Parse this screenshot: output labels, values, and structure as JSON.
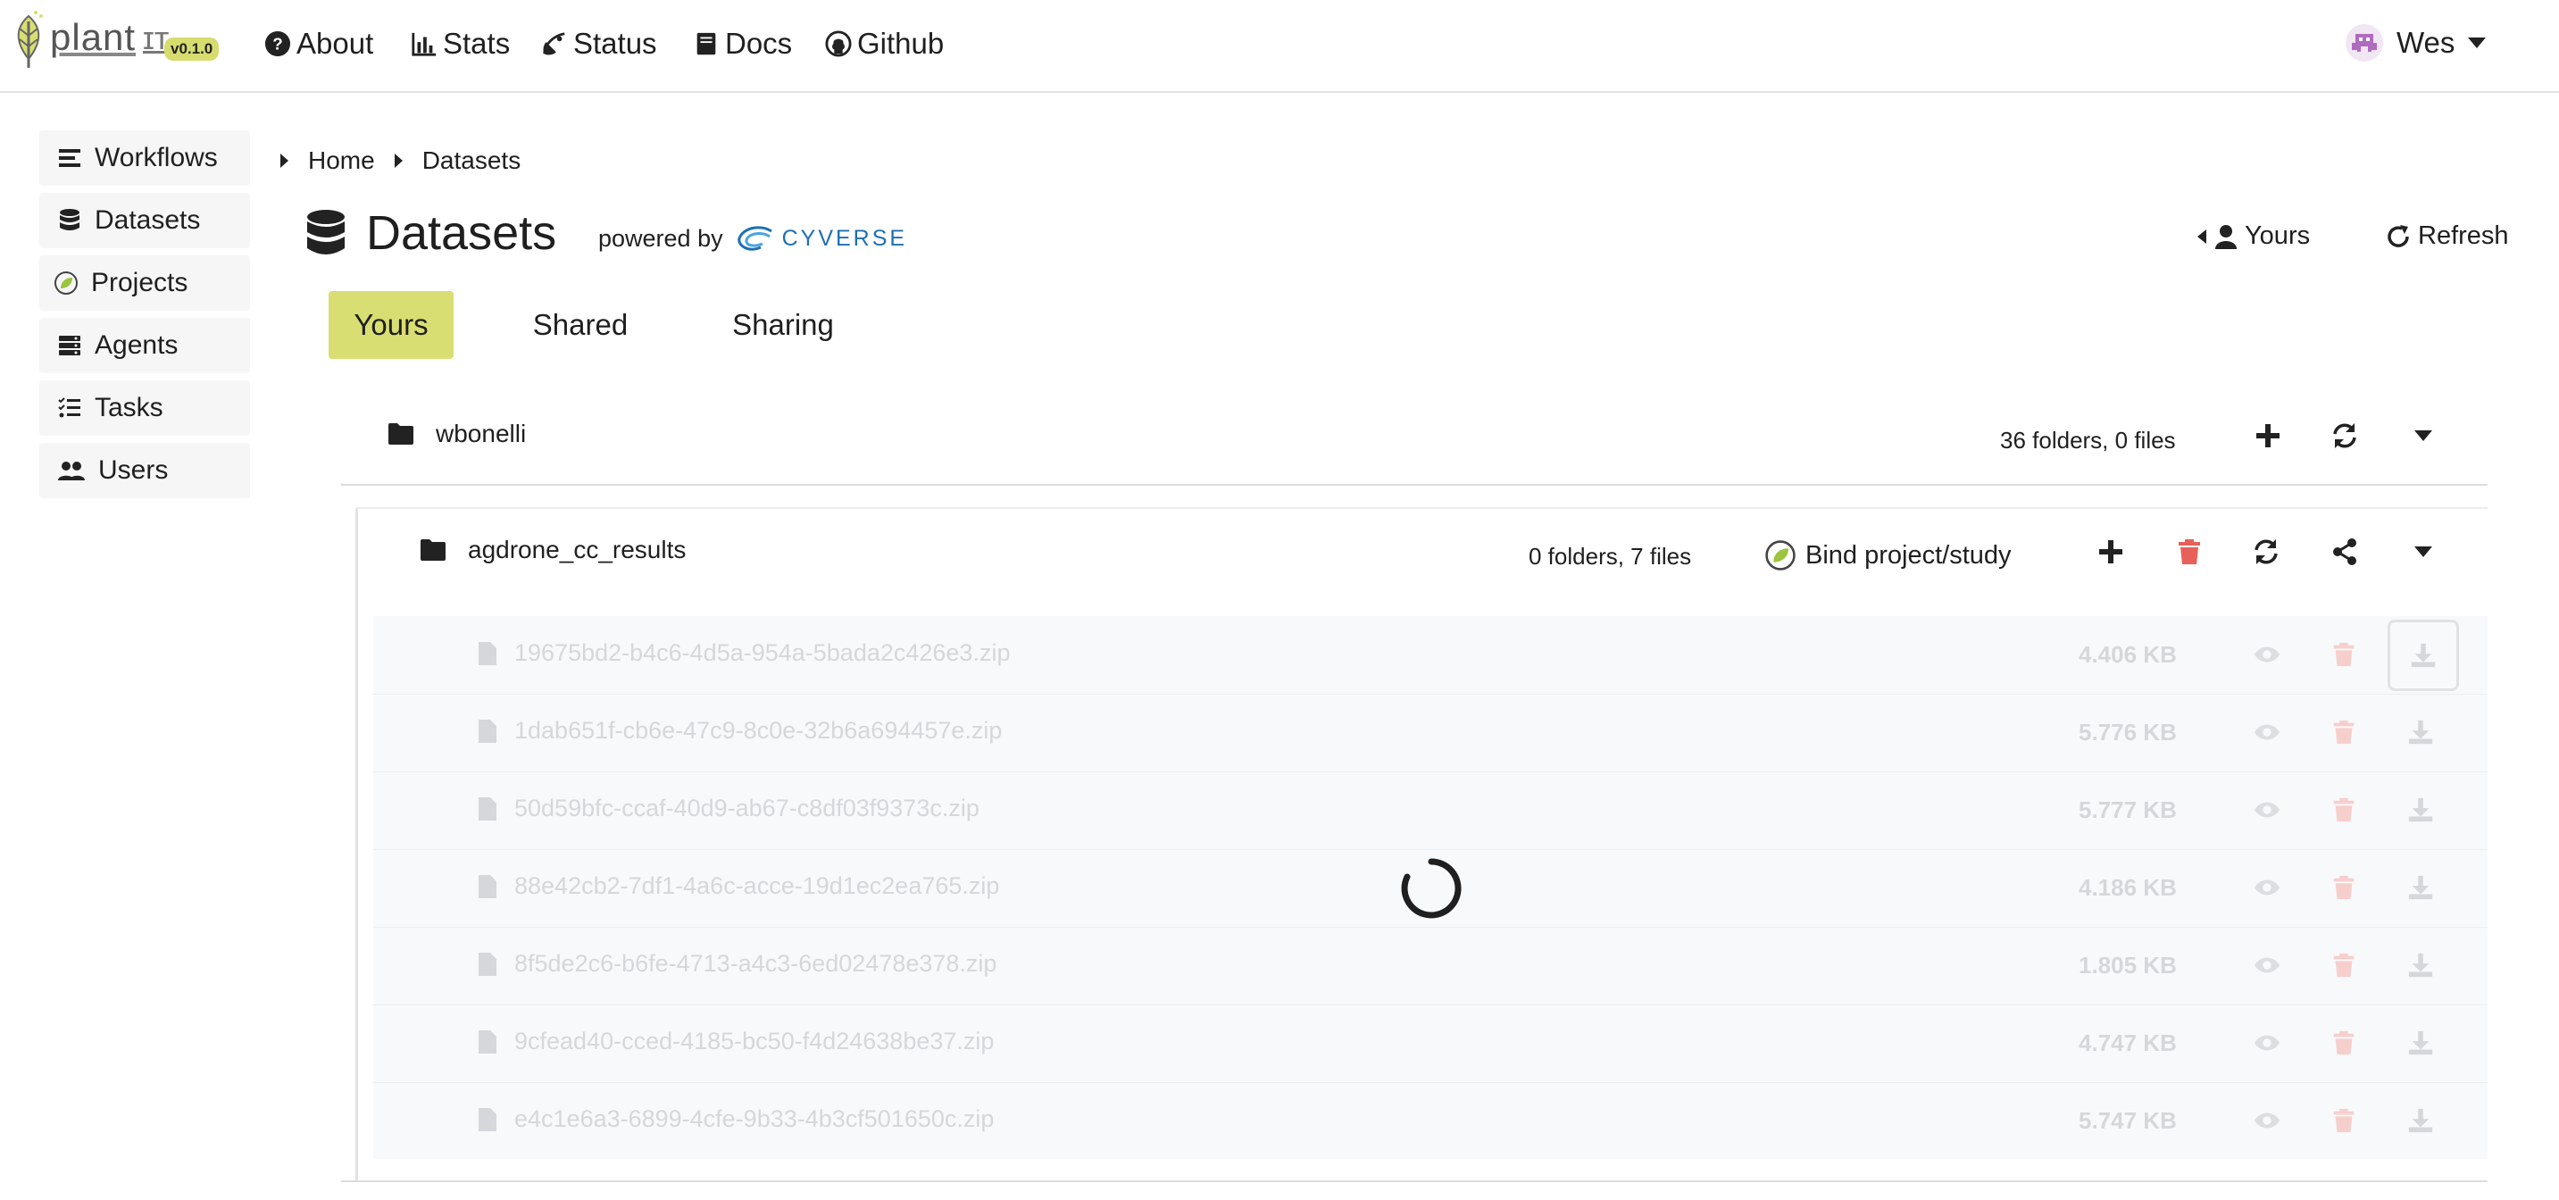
{
  "navbar": {
    "logo_text": "plant",
    "version": "v0.1.0",
    "links": [
      "About",
      "Stats",
      "Status",
      "Docs",
      "Github"
    ],
    "user_name": "Wes"
  },
  "sidebar": {
    "items": [
      {
        "label": "Workflows",
        "icon": "list-icon"
      },
      {
        "label": "Datasets",
        "icon": "database-icon"
      },
      {
        "label": "Projects",
        "icon": "leaf-circle-icon"
      },
      {
        "label": "Agents",
        "icon": "server-icon"
      },
      {
        "label": "Tasks",
        "icon": "tasks-icon"
      },
      {
        "label": "Users",
        "icon": "users-icon"
      }
    ]
  },
  "breadcrumb": [
    "Home",
    "Datasets"
  ],
  "header": {
    "title": "Datasets",
    "powered_by": "powered by",
    "brand": "CYVERSE",
    "yours_button": "Yours",
    "refresh_button": "Refresh"
  },
  "tabs": [
    {
      "label": "Yours",
      "active": true
    },
    {
      "label": "Shared",
      "active": false
    },
    {
      "label": "Sharing",
      "active": false
    }
  ],
  "root_folder": {
    "name": "wbonelli",
    "summary": "36 folders, 0 files"
  },
  "sub_folder": {
    "name": "agdrone_cc_results",
    "summary": "0 folders, 7 files",
    "bind_label": "Bind project/study"
  },
  "files": [
    {
      "name": "19675bd2-b4c6-4d5a-954a-5bada2c426e3.zip",
      "size": "4.406 KB"
    },
    {
      "name": "1dab651f-cb6e-47c9-8c0e-32b6a694457e.zip",
      "size": "5.776 KB"
    },
    {
      "name": "50d59bfc-ccaf-40d9-ab67-c8df03f9373c.zip",
      "size": "5.777 KB"
    },
    {
      "name": "88e42cb2-7df1-4a6c-acce-19d1ec2ea765.zip",
      "size": "4.186 KB"
    },
    {
      "name": "8f5de2c6-b6fe-4713-a4c3-6ed02478e378.zip",
      "size": "1.805 KB"
    },
    {
      "name": "9cfead40-cced-4185-bc50-f4d24638be37.zip",
      "size": "4.747 KB"
    },
    {
      "name": "e4c1e6a3-6899-4cfe-9b33-4b3cf501650c.zip",
      "size": "5.747 KB"
    }
  ],
  "colors": {
    "accent": "#d9de72",
    "delete": "#e8605a",
    "brand_blue": "#1d6fb4",
    "faded_text": "#d5d7da"
  },
  "state": {
    "loading": true
  }
}
